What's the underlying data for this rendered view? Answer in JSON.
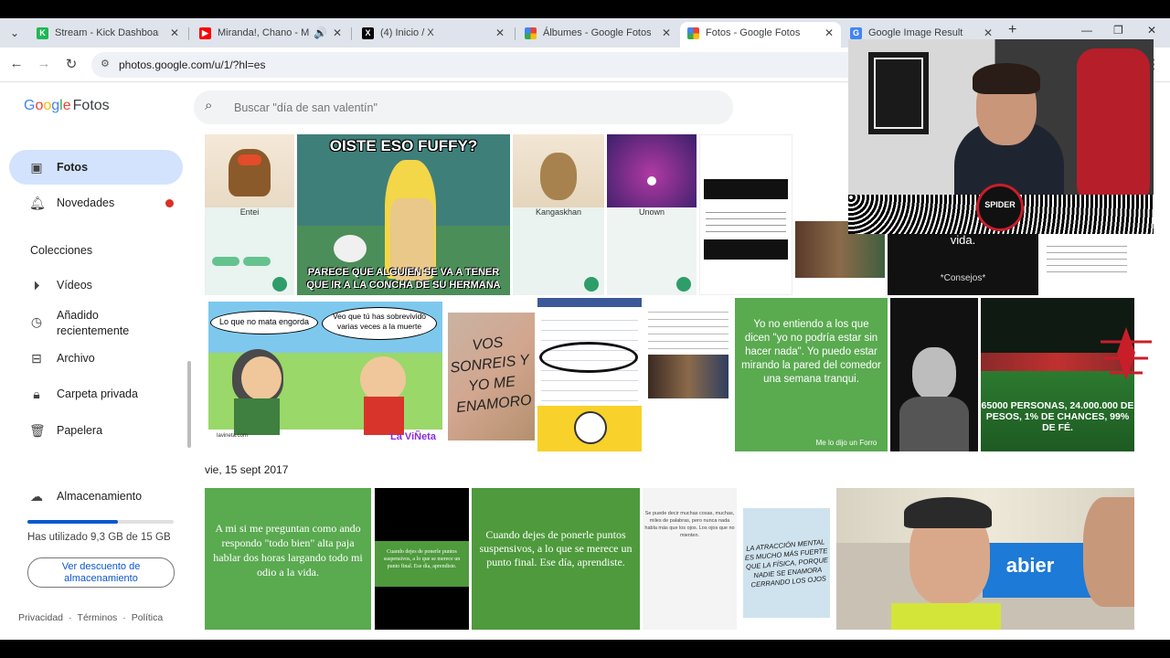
{
  "browser": {
    "tabs": [
      {
        "title": "Stream - Kick Dashboard",
        "favicon": "kick-icon",
        "color": "#1db954"
      },
      {
        "title": "Miranda!, Chano - Mer",
        "favicon": "youtube-icon",
        "color": "#ff0000"
      },
      {
        "title": "(4) Inicio / X",
        "favicon": "x-icon",
        "color": "#000000"
      },
      {
        "title": "Álbumes - Google Fotos",
        "favicon": "google-photos-icon",
        "color": "#fbbc05"
      },
      {
        "title": "Fotos - Google Fotos",
        "favicon": "google-photos-icon",
        "color": "#fbbc05"
      },
      {
        "title": "Google Image Result",
        "favicon": "google-icon",
        "color": "#4285f4"
      }
    ],
    "url": "photos.google.com/u/1/?hl=es"
  },
  "sidebar": {
    "logo_google": [
      "G",
      "o",
      "o",
      "g",
      "l",
      "e"
    ],
    "logo_app": "Fotos",
    "items": [
      {
        "label": "Fotos",
        "icon": "photo-icon"
      },
      {
        "label": "Novedades",
        "icon": "bell-icon"
      }
    ],
    "collections_heading": "Colecciones",
    "collections": [
      {
        "label": "Vídeos",
        "icon": "play-circle-icon"
      },
      {
        "label": "Añadido recientemente",
        "icon": "clock-icon"
      },
      {
        "label": "Archivo",
        "icon": "archive-icon"
      },
      {
        "label": "Carpeta privada",
        "icon": "lock-icon"
      },
      {
        "label": "Papelera",
        "icon": "trash-icon"
      }
    ],
    "storage": {
      "label": "Almacenamiento",
      "used_text": "Has utilizado 9,3 GB de 15 GB",
      "used_fraction": 0.62,
      "button": "Ver descuento de almacenamiento"
    },
    "footer": [
      "Privacidad",
      "·",
      "Términos",
      "·",
      "Política"
    ]
  },
  "search": {
    "placeholder": "Buscar \"día de san valentín\""
  },
  "photos": {
    "row1": {
      "entei_name": "Entei",
      "meme_top": "OISTE ESO FUFFY?",
      "meme_bottom": "PARECE QUE ALGUIEN SE VA A TENER QUE IR A LA CONCHA DE SU HERMANA",
      "kangaskhan_name": "Kangaskhan",
      "unown_name": "Unown",
      "vida": "vida.",
      "consejos": "*Consejos*"
    },
    "row2": {
      "comic_left": "Lo que no mata engorda",
      "comic_right": "Veo que tú has sobrevivido varias veces a la muerte",
      "comic_brand": "La ViÑeta",
      "comic_site": "lavineta.com",
      "wall_text": "VOS SONREIS Y YO ME ENAMORO",
      "green_quote": "Yo no entiendo a los que dicen \"yo no podría estar sin hacer nada\". Yo puedo estar mirando la pared del comedor una semana tranqui.",
      "green_sig": "Me lo dijo un Forro",
      "stadium": "65000 PERSONAS, 24.000.000 DE PESOS, 1% DE CHANCES, 99% DE FÉ."
    },
    "date_header": "vie, 15 sept 2017",
    "row3": {
      "quote1": "A mi si me preguntan como ando respondo \"todo bien\" alta paja hablar dos horas largando todo mi odio a la vida.",
      "quote2": "Cuando dejes de ponerle puntos suspensivos, a lo que se merece un punto final. Ese día, aprendiste.",
      "quote3": "Cuando dejes de ponerle puntos suspensivos, a lo que se merece un punto final. Ese día, aprendiste.",
      "handwriting": "LA ATRACCIÓN MENTAL ES MUCHO MÁS FUERTE QUE LA FÍSICA, PORQUE NADIE SE ENAMORA CERRANDO LOS OJOS",
      "small_text": "Se puede decir muchas cosas, muchas, miles de palabras, pero nunca nada habla más que los ojos. Los ojos que no mienten.",
      "banner": "abier"
    }
  },
  "webcam": {
    "badge": "SPIDER",
    "label": "webcam-overlay"
  }
}
